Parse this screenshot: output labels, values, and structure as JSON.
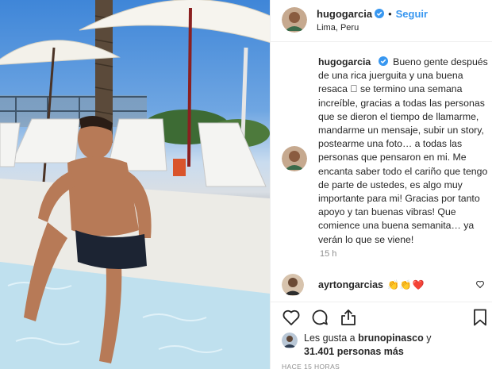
{
  "post": {
    "username": "hugogarcia",
    "follow_label": "Seguir",
    "separator": "•",
    "location": "Lima, Peru",
    "caption": "Bueno gente después de una rica juerguita y una buena resaca ⃞ se termino una semana increíble, gracias a todas las personas que se dieron el tiempo de llamarme, mandarme un mensaje, subir un story, postearme una foto… a todas las personas que pensaron en mi. Me encanta saber todo el cariño que tengo de parte de ustedes, es algo muy importante para mi! Gracias por tanto apoyo y tan buenas vibras! Que comience una buena semanita… ya verán lo que se viene!",
    "time_ago": "15 h"
  },
  "comment": {
    "username": "ayrtongarcias",
    "text": "👏👏❤️"
  },
  "likes": {
    "prefix": "Les gusta a",
    "liker": "brunopinasco",
    "conjunction": "y",
    "count_text": "31.401 personas más"
  },
  "posted_label": "HACE 15 HORAS",
  "icons": {
    "verified": "verified-badge-icon",
    "like": "heart-icon",
    "comment": "comment-icon",
    "share": "share-icon",
    "save": "bookmark-icon",
    "comment_like": "heart-icon"
  },
  "colors": {
    "link_blue": "#3897f0",
    "verified_blue": "#3897f0",
    "muted_gray": "#8e8e8e",
    "text": "#262626",
    "heart_red": "#ed4956"
  }
}
